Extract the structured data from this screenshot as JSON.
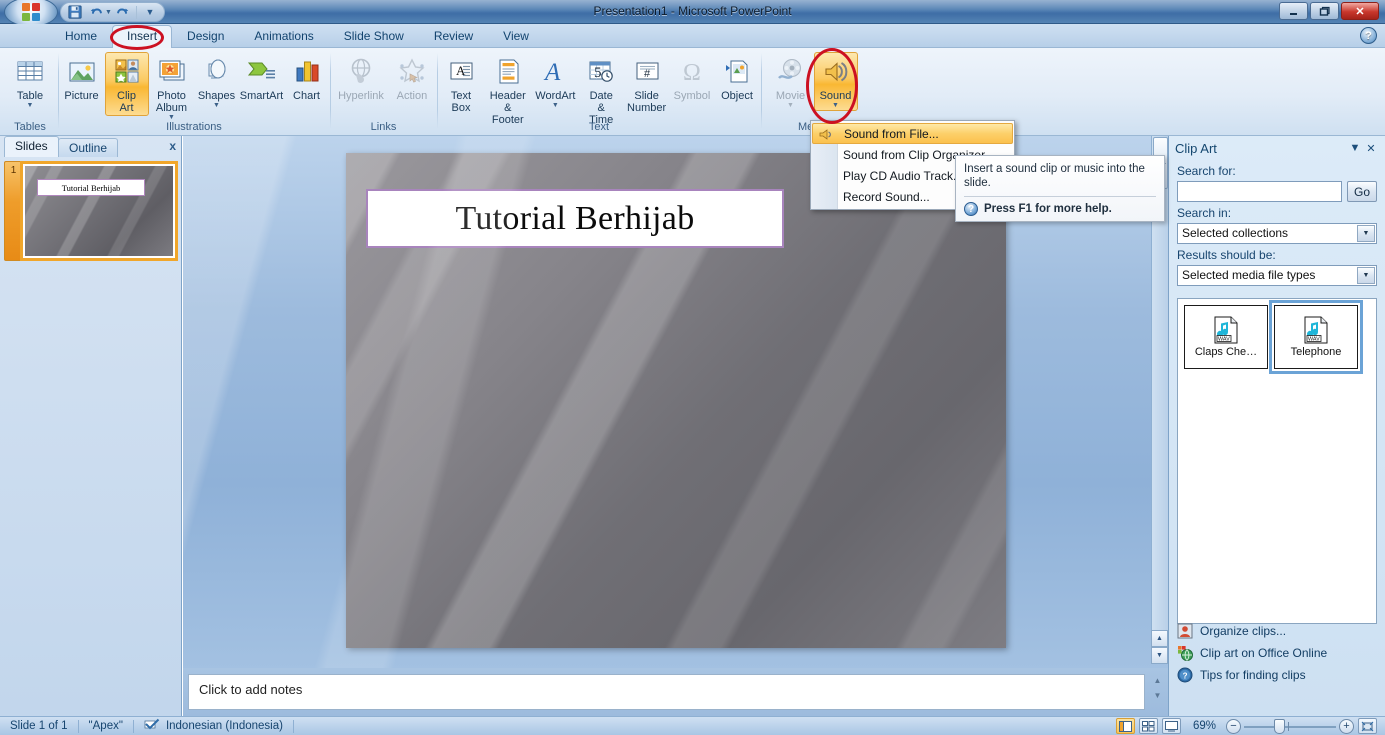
{
  "window": {
    "title": "Presentation1 - Microsoft PowerPoint",
    "minimize": "–",
    "restore": "❐",
    "close": "✕"
  },
  "quick_access": {
    "save": "save-icon",
    "undo": "undo-icon",
    "redo": "redo-icon",
    "customize": "customize-icon"
  },
  "tabs": [
    {
      "label": "Home",
      "active": false
    },
    {
      "label": "Insert",
      "active": true
    },
    {
      "label": "Design",
      "active": false
    },
    {
      "label": "Animations",
      "active": false
    },
    {
      "label": "Slide Show",
      "active": false
    },
    {
      "label": "Review",
      "active": false
    },
    {
      "label": "View",
      "active": false
    }
  ],
  "help_button": "?",
  "ribbon": {
    "groups": [
      {
        "label": "Tables"
      },
      {
        "label": "Illustrations"
      },
      {
        "label": "Links"
      },
      {
        "label": "Text"
      },
      {
        "label": "Media"
      }
    ],
    "buttons": {
      "table": "Table",
      "picture": "Picture",
      "clip_art": "Clip\nArt",
      "photo_album": "Photo\nAlbum",
      "shapes": "Shapes",
      "smartart": "SmartArt",
      "chart": "Chart",
      "hyperlink": "Hyperlink",
      "action": "Action",
      "text_box": "Text\nBox",
      "header_footer": "Header\n& Footer",
      "wordart": "WordArt",
      "date_time": "Date\n& Time",
      "slide_number": "Slide\nNumber",
      "symbol": "Symbol",
      "object": "Object",
      "movie": "Movie",
      "sound": "Sound"
    }
  },
  "sound_menu": {
    "items": [
      {
        "label": "Sound from File...",
        "accel_index": 11,
        "highlighted": true
      },
      {
        "label": "Sound from Clip Organizer",
        "accel_index": 0,
        "highlighted": false
      },
      {
        "label": "Play CD Audio Track...",
        "accel_index": 5,
        "highlighted": false
      },
      {
        "label": "Record Sound...",
        "accel_index": 0,
        "highlighted": false
      }
    ]
  },
  "tooltip": {
    "body": "Insert a sound clip or music into the slide.",
    "footer": "Press F1 for more help.",
    "icon": "help-circle-icon"
  },
  "left_pane": {
    "tabs": [
      {
        "label": "Slides",
        "active": true
      },
      {
        "label": "Outline",
        "active": false
      }
    ],
    "close": "x",
    "slide_number": "1",
    "thumbnail_title": "Tutorial Berhijab"
  },
  "slide": {
    "title": "Tutorial Berhijab"
  },
  "notes": {
    "placeholder": "Click to add notes"
  },
  "clip_art": {
    "title": "Clip Art",
    "menu_arrow": "▼",
    "close": "✕",
    "search_for_label": "Search for:",
    "search_value": "",
    "go_label": "Go",
    "search_in_label": "Search in:",
    "search_in_value": "Selected collections",
    "results_label": "Results should be:",
    "results_value": "Selected media file types",
    "items": [
      {
        "label": "Claps Che…",
        "type": "WAV",
        "selected": false
      },
      {
        "label": "Telephone",
        "type": "WAV",
        "selected": true
      }
    ],
    "links": [
      {
        "label": "Organize clips...",
        "icon": "organize-clips-icon"
      },
      {
        "label": "Clip art on Office Online",
        "icon": "office-online-icon"
      },
      {
        "label": "Tips for finding clips",
        "icon": "help-circle-icon"
      }
    ]
  },
  "status_bar": {
    "slide_count": "Slide 1 of 1",
    "theme": "\"Apex\"",
    "spellcheck_icon": "spellcheck-icon",
    "language": "Indonesian (Indonesia)",
    "zoom_level": "69%",
    "zoom_out": "−",
    "zoom_in": "+",
    "views": [
      {
        "name": "normal-view",
        "active": true
      },
      {
        "name": "slide-sorter-view",
        "active": false
      },
      {
        "name": "slide-show-view",
        "active": false
      }
    ]
  },
  "colors": {
    "accent_orange": "#f9b733",
    "annotation_red": "#cc1122",
    "title_border_purple": "#a884bd",
    "ribbon_blue": "#cfe0f2"
  }
}
